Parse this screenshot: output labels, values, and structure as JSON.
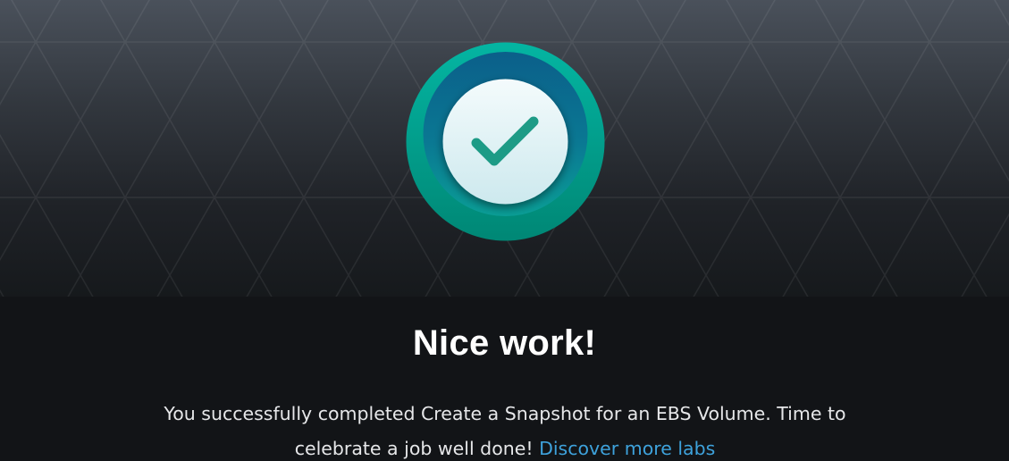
{
  "badge": {
    "icon": "check-icon",
    "colors": {
      "outer_ring": "#00a58f",
      "inner_ring": "#0b6a8f",
      "disc": "#e9f6f8",
      "check": "#1b9a85"
    }
  },
  "completion": {
    "title": "Nice work!",
    "message_before": "You successfully completed Create a Snapshot for an EBS Volume. Time to celebrate a job well done! ",
    "link_label": "Discover more labs"
  },
  "colors": {
    "background": "#121417",
    "link": "#3ea2dc",
    "title": "#ffffff"
  }
}
